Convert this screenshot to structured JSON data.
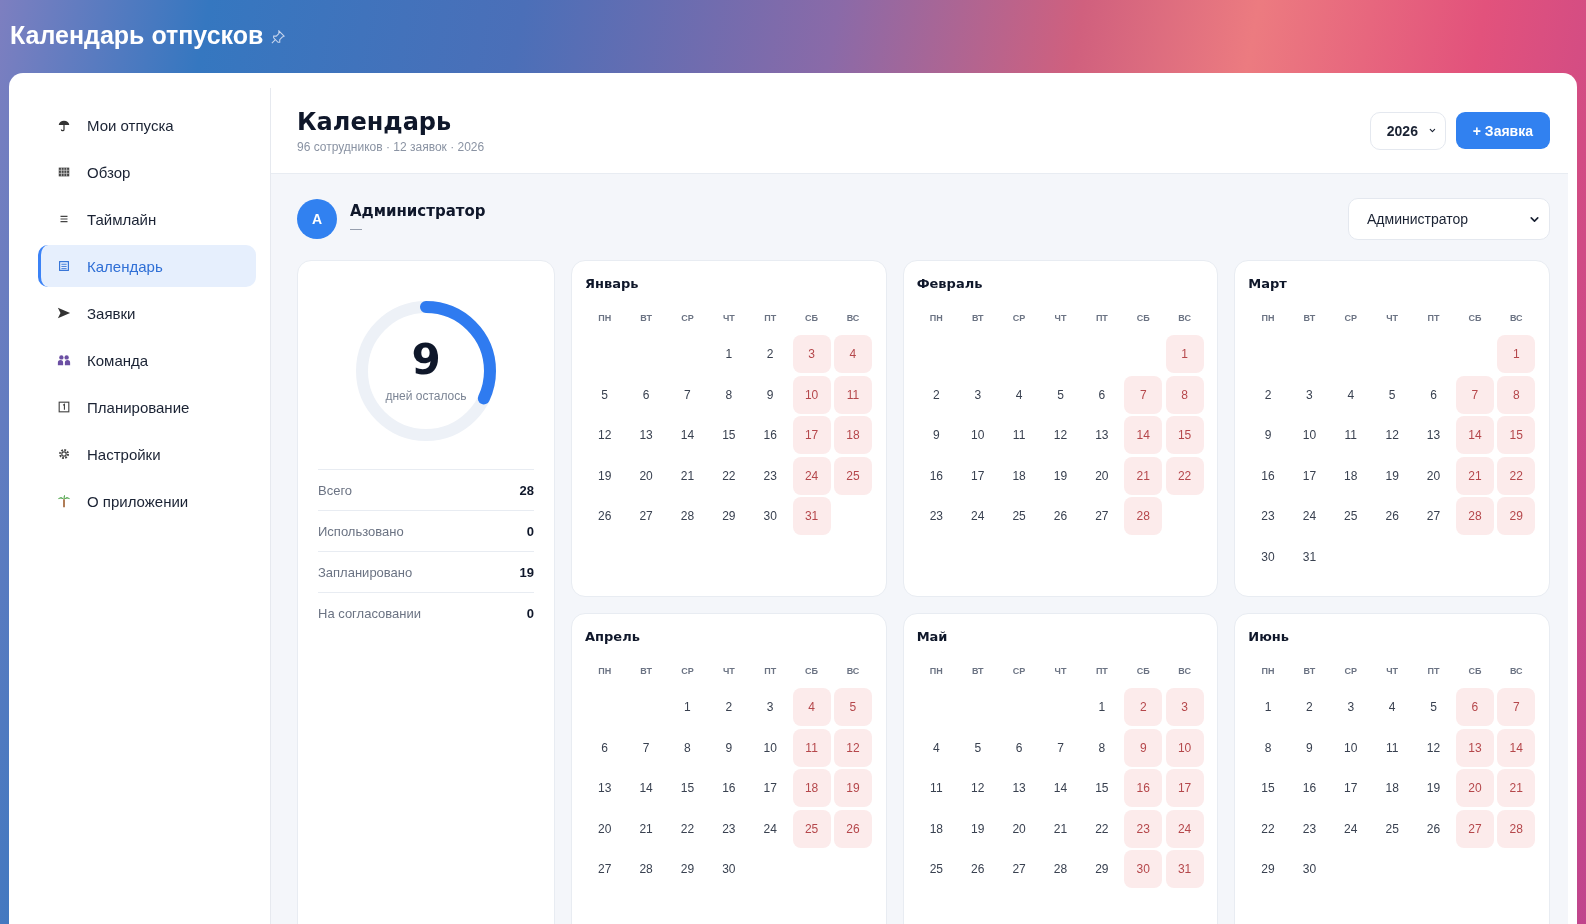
{
  "app_title": "Календарь отпусков",
  "sidebar": {
    "items": [
      {
        "label": "Мои отпуска",
        "selected": false
      },
      {
        "label": "Обзор",
        "selected": false
      },
      {
        "label": "Таймлайн",
        "selected": false
      },
      {
        "label": "Календарь",
        "selected": true
      },
      {
        "label": "Заявки",
        "selected": false
      },
      {
        "label": "Команда",
        "selected": false
      },
      {
        "label": "Планирование",
        "selected": false
      },
      {
        "label": "Настройки",
        "selected": false
      },
      {
        "label": "О приложении",
        "selected": false
      }
    ]
  },
  "header": {
    "title": "Календарь",
    "subtitle": "96 сотрудников · 12 заявок · 2026",
    "year_select": "2026",
    "new_button": "+ Заявка"
  },
  "user": {
    "avatar": "А",
    "name": "Администратор",
    "role": "—",
    "select": "Администратор"
  },
  "summary": {
    "remaining": "9",
    "remaining_label": "дней осталось",
    "level": 0.32,
    "stats": [
      {
        "label": "Всего",
        "value": "28"
      },
      {
        "label": "Использовано",
        "value": "0"
      },
      {
        "label": "Запланировано",
        "value": "19"
      },
      {
        "label": "На согласовании",
        "value": "0"
      }
    ]
  },
  "months": [
    {
      "name": "Январь",
      "weekdays": [
        "ПН",
        "ВТ",
        "СР",
        "ЧТ",
        "ПТ",
        "СБ",
        "ВС"
      ],
      "weeks": [
        [
          {
            "kind": "empty"
          },
          {
            "kind": "empty"
          },
          {
            "kind": "empty"
          },
          {
            "kind": "day",
            "day": "1",
            "weekend": false
          },
          {
            "kind": "day",
            "day": "2",
            "weekend": false
          },
          {
            "kind": "day",
            "day": "3",
            "weekend": true
          },
          {
            "kind": "day",
            "day": "4",
            "weekend": true
          }
        ],
        [
          {
            "kind": "day",
            "day": "5",
            "weekend": false
          },
          {
            "kind": "day",
            "day": "6",
            "weekend": false
          },
          {
            "kind": "day",
            "day": "7",
            "weekend": false
          },
          {
            "kind": "day",
            "day": "8",
            "weekend": false
          },
          {
            "kind": "day",
            "day": "9",
            "weekend": false
          },
          {
            "kind": "day",
            "day": "10",
            "weekend": true
          },
          {
            "kind": "day",
            "day": "11",
            "weekend": true
          }
        ],
        [
          {
            "kind": "day",
            "day": "12",
            "weekend": false
          },
          {
            "kind": "day",
            "day": "13",
            "weekend": false
          },
          {
            "kind": "day",
            "day": "14",
            "weekend": false
          },
          {
            "kind": "day",
            "day": "15",
            "weekend": false
          },
          {
            "kind": "day",
            "day": "16",
            "weekend": false
          },
          {
            "kind": "day",
            "day": "17",
            "weekend": true
          },
          {
            "kind": "day",
            "day": "18",
            "weekend": true
          }
        ],
        [
          {
            "kind": "day",
            "day": "19",
            "weekend": false
          },
          {
            "kind": "day",
            "day": "20",
            "weekend": false
          },
          {
            "kind": "day",
            "day": "21",
            "weekend": false
          },
          {
            "kind": "day",
            "day": "22",
            "weekend": false
          },
          {
            "kind": "day",
            "day": "23",
            "weekend": false
          },
          {
            "kind": "day",
            "day": "24",
            "weekend": true
          },
          {
            "kind": "day",
            "day": "25",
            "weekend": true
          }
        ],
        [
          {
            "kind": "day",
            "day": "26",
            "weekend": false
          },
          {
            "kind": "day",
            "day": "27",
            "weekend": false
          },
          {
            "kind": "day",
            "day": "28",
            "weekend": false
          },
          {
            "kind": "day",
            "day": "29",
            "weekend": false
          },
          {
            "kind": "day",
            "day": "30",
            "weekend": false
          },
          {
            "kind": "day",
            "day": "31",
            "weekend": true
          },
          {
            "kind": "empty"
          }
        ]
      ]
    },
    {
      "name": "Февраль",
      "weekdays": [
        "ПН",
        "ВТ",
        "СР",
        "ЧТ",
        "ПТ",
        "СБ",
        "ВС"
      ],
      "weeks": [
        [
          {
            "kind": "empty"
          },
          {
            "kind": "empty"
          },
          {
            "kind": "empty"
          },
          {
            "kind": "empty"
          },
          {
            "kind": "empty"
          },
          {
            "kind": "empty"
          },
          {
            "kind": "day",
            "day": "1",
            "weekend": true
          }
        ],
        [
          {
            "kind": "day",
            "day": "2",
            "weekend": false
          },
          {
            "kind": "day",
            "day": "3",
            "weekend": false
          },
          {
            "kind": "day",
            "day": "4",
            "weekend": false
          },
          {
            "kind": "day",
            "day": "5",
            "weekend": false
          },
          {
            "kind": "day",
            "day": "6",
            "weekend": false
          },
          {
            "kind": "day",
            "day": "7",
            "weekend": true
          },
          {
            "kind": "day",
            "day": "8",
            "weekend": true
          }
        ],
        [
          {
            "kind": "day",
            "day": "9",
            "weekend": false
          },
          {
            "kind": "day",
            "day": "10",
            "weekend": false
          },
          {
            "kind": "day",
            "day": "11",
            "weekend": false
          },
          {
            "kind": "day",
            "day": "12",
            "weekend": false
          },
          {
            "kind": "day",
            "day": "13",
            "weekend": false
          },
          {
            "kind": "day",
            "day": "14",
            "weekend": true
          },
          {
            "kind": "day",
            "day": "15",
            "weekend": true
          }
        ],
        [
          {
            "kind": "day",
            "day": "16",
            "weekend": false
          },
          {
            "kind": "day",
            "day": "17",
            "weekend": false
          },
          {
            "kind": "day",
            "day": "18",
            "weekend": false
          },
          {
            "kind": "day",
            "day": "19",
            "weekend": false
          },
          {
            "kind": "day",
            "day": "20",
            "weekend": false
          },
          {
            "kind": "day",
            "day": "21",
            "weekend": true
          },
          {
            "kind": "day",
            "day": "22",
            "weekend": true
          }
        ],
        [
          {
            "kind": "day",
            "day": "23",
            "weekend": false
          },
          {
            "kind": "day",
            "day": "24",
            "weekend": false
          },
          {
            "kind": "day",
            "day": "25",
            "weekend": false
          },
          {
            "kind": "day",
            "day": "26",
            "weekend": false
          },
          {
            "kind": "day",
            "day": "27",
            "weekend": false
          },
          {
            "kind": "day",
            "day": "28",
            "weekend": true
          },
          {
            "kind": "empty"
          }
        ]
      ]
    },
    {
      "name": "Март",
      "weekdays": [
        "ПН",
        "ВТ",
        "СР",
        "ЧТ",
        "ПТ",
        "СБ",
        "ВС"
      ],
      "weeks": [
        [
          {
            "kind": "empty"
          },
          {
            "kind": "empty"
          },
          {
            "kind": "empty"
          },
          {
            "kind": "empty"
          },
          {
            "kind": "empty"
          },
          {
            "kind": "empty"
          },
          {
            "kind": "day",
            "day": "1",
            "weekend": true
          }
        ],
        [
          {
            "kind": "day",
            "day": "2",
            "weekend": false
          },
          {
            "kind": "day",
            "day": "3",
            "weekend": false
          },
          {
            "kind": "day",
            "day": "4",
            "weekend": false
          },
          {
            "kind": "day",
            "day": "5",
            "weekend": false
          },
          {
            "kind": "day",
            "day": "6",
            "weekend": false
          },
          {
            "kind": "day",
            "day": "7",
            "weekend": true
          },
          {
            "kind": "day",
            "day": "8",
            "weekend": true
          }
        ],
        [
          {
            "kind": "day",
            "day": "9",
            "weekend": false
          },
          {
            "kind": "day",
            "day": "10",
            "weekend": false
          },
          {
            "kind": "day",
            "day": "11",
            "weekend": false
          },
          {
            "kind": "day",
            "day": "12",
            "weekend": false
          },
          {
            "kind": "day",
            "day": "13",
            "weekend": false
          },
          {
            "kind": "day",
            "day": "14",
            "weekend": true
          },
          {
            "kind": "day",
            "day": "15",
            "weekend": true
          }
        ],
        [
          {
            "kind": "day",
            "day": "16",
            "weekend": false
          },
          {
            "kind": "day",
            "day": "17",
            "weekend": false
          },
          {
            "kind": "day",
            "day": "18",
            "weekend": false
          },
          {
            "kind": "day",
            "day": "19",
            "weekend": false
          },
          {
            "kind": "day",
            "day": "20",
            "weekend": false
          },
          {
            "kind": "day",
            "day": "21",
            "weekend": true
          },
          {
            "kind": "day",
            "day": "22",
            "weekend": true
          }
        ],
        [
          {
            "kind": "day",
            "day": "23",
            "weekend": false
          },
          {
            "kind": "day",
            "day": "24",
            "weekend": false
          },
          {
            "kind": "day",
            "day": "25",
            "weekend": false
          },
          {
            "kind": "day",
            "day": "26",
            "weekend": false
          },
          {
            "kind": "day",
            "day": "27",
            "weekend": false
          },
          {
            "kind": "day",
            "day": "28",
            "weekend": true
          },
          {
            "kind": "day",
            "day": "29",
            "weekend": true
          }
        ],
        [
          {
            "kind": "day",
            "day": "30",
            "weekend": false
          },
          {
            "kind": "day",
            "day": "31",
            "weekend": false
          },
          {
            "kind": "empty"
          },
          {
            "kind": "empty"
          },
          {
            "kind": "empty"
          },
          {
            "kind": "empty"
          },
          {
            "kind": "empty"
          }
        ]
      ]
    },
    {
      "name": "Апрель",
      "weekdays": [
        "ПН",
        "ВТ",
        "СР",
        "ЧТ",
        "ПТ",
        "СБ",
        "ВС"
      ],
      "weeks": [
        [
          {
            "kind": "empty"
          },
          {
            "kind": "empty"
          },
          {
            "kind": "day",
            "day": "1",
            "weekend": false
          },
          {
            "kind": "day",
            "day": "2",
            "weekend": false
          },
          {
            "kind": "day",
            "day": "3",
            "weekend": false
          },
          {
            "kind": "day",
            "day": "4",
            "weekend": true
          },
          {
            "kind": "day",
            "day": "5",
            "weekend": true
          }
        ],
        [
          {
            "kind": "day",
            "day": "6",
            "weekend": false
          },
          {
            "kind": "day",
            "day": "7",
            "weekend": false
          },
          {
            "kind": "day",
            "day": "8",
            "weekend": false
          },
          {
            "kind": "day",
            "day": "9",
            "weekend": false
          },
          {
            "kind": "day",
            "day": "10",
            "weekend": false
          },
          {
            "kind": "day",
            "day": "11",
            "weekend": true
          },
          {
            "kind": "day",
            "day": "12",
            "weekend": true
          }
        ],
        [
          {
            "kind": "day",
            "day": "13",
            "weekend": false
          },
          {
            "kind": "day",
            "day": "14",
            "weekend": false
          },
          {
            "kind": "day",
            "day": "15",
            "weekend": false
          },
          {
            "kind": "day",
            "day": "16",
            "weekend": false
          },
          {
            "kind": "day",
            "day": "17",
            "weekend": false
          },
          {
            "kind": "day",
            "day": "18",
            "weekend": true
          },
          {
            "kind": "day",
            "day": "19",
            "weekend": true
          }
        ],
        [
          {
            "kind": "day",
            "day": "20",
            "weekend": false
          },
          {
            "kind": "day",
            "day": "21",
            "weekend": false
          },
          {
            "kind": "day",
            "day": "22",
            "weekend": false
          },
          {
            "kind": "day",
            "day": "23",
            "weekend": false
          },
          {
            "kind": "day",
            "day": "24",
            "weekend": false
          },
          {
            "kind": "day",
            "day": "25",
            "weekend": true
          },
          {
            "kind": "day",
            "day": "26",
            "weekend": true
          }
        ],
        [
          {
            "kind": "day",
            "day": "27",
            "weekend": false
          },
          {
            "kind": "day",
            "day": "28",
            "weekend": false
          },
          {
            "kind": "day",
            "day": "29",
            "weekend": false
          },
          {
            "kind": "day",
            "day": "30",
            "weekend": false
          },
          {
            "kind": "empty"
          },
          {
            "kind": "empty"
          },
          {
            "kind": "empty"
          }
        ]
      ]
    },
    {
      "name": "Май",
      "weekdays": [
        "ПН",
        "ВТ",
        "СР",
        "ЧТ",
        "ПТ",
        "СБ",
        "ВС"
      ],
      "weeks": [
        [
          {
            "kind": "empty"
          },
          {
            "kind": "empty"
          },
          {
            "kind": "empty"
          },
          {
            "kind": "empty"
          },
          {
            "kind": "day",
            "day": "1",
            "weekend": false
          },
          {
            "kind": "day",
            "day": "2",
            "weekend": true
          },
          {
            "kind": "day",
            "day": "3",
            "weekend": true
          }
        ],
        [
          {
            "kind": "day",
            "day": "4",
            "weekend": false
          },
          {
            "kind": "day",
            "day": "5",
            "weekend": false
          },
          {
            "kind": "day",
            "day": "6",
            "weekend": false
          },
          {
            "kind": "day",
            "day": "7",
            "weekend": false
          },
          {
            "kind": "day",
            "day": "8",
            "weekend": false
          },
          {
            "kind": "day",
            "day": "9",
            "weekend": true
          },
          {
            "kind": "day",
            "day": "10",
            "weekend": true
          }
        ],
        [
          {
            "kind": "day",
            "day": "11",
            "weekend": false
          },
          {
            "kind": "day",
            "day": "12",
            "weekend": false
          },
          {
            "kind": "day",
            "day": "13",
            "weekend": false
          },
          {
            "kind": "day",
            "day": "14",
            "weekend": false
          },
          {
            "kind": "day",
            "day": "15",
            "weekend": false
          },
          {
            "kind": "day",
            "day": "16",
            "weekend": true
          },
          {
            "kind": "day",
            "day": "17",
            "weekend": true
          }
        ],
        [
          {
            "kind": "day",
            "day": "18",
            "weekend": false
          },
          {
            "kind": "day",
            "day": "19",
            "weekend": false
          },
          {
            "kind": "day",
            "day": "20",
            "weekend": false
          },
          {
            "kind": "day",
            "day": "21",
            "weekend": false
          },
          {
            "kind": "day",
            "day": "22",
            "weekend": false
          },
          {
            "kind": "day",
            "day": "23",
            "weekend": true
          },
          {
            "kind": "day",
            "day": "24",
            "weekend": true
          }
        ],
        [
          {
            "kind": "day",
            "day": "25",
            "weekend": false
          },
          {
            "kind": "day",
            "day": "26",
            "weekend": false
          },
          {
            "kind": "day",
            "day": "27",
            "weekend": false
          },
          {
            "kind": "day",
            "day": "28",
            "weekend": false
          },
          {
            "kind": "day",
            "day": "29",
            "weekend": false
          },
          {
            "kind": "day",
            "day": "30",
            "weekend": true
          },
          {
            "kind": "day",
            "day": "31",
            "weekend": true
          }
        ]
      ]
    },
    {
      "name": "Июнь",
      "weekdays": [
        "ПН",
        "ВТ",
        "СР",
        "ЧТ",
        "ПТ",
        "СБ",
        "ВС"
      ],
      "weeks": [
        [
          {
            "kind": "day",
            "day": "1",
            "weekend": false
          },
          {
            "kind": "day",
            "day": "2",
            "weekend": false
          },
          {
            "kind": "day",
            "day": "3",
            "weekend": false
          },
          {
            "kind": "day",
            "day": "4",
            "weekend": false
          },
          {
            "kind": "day",
            "day": "5",
            "weekend": false
          },
          {
            "kind": "day",
            "day": "6",
            "weekend": true
          },
          {
            "kind": "day",
            "day": "7",
            "weekend": true
          }
        ],
        [
          {
            "kind": "day",
            "day": "8",
            "weekend": false
          },
          {
            "kind": "day",
            "day": "9",
            "weekend": false
          },
          {
            "kind": "day",
            "day": "10",
            "weekend": false
          },
          {
            "kind": "day",
            "day": "11",
            "weekend": false
          },
          {
            "kind": "day",
            "day": "12",
            "weekend": false
          },
          {
            "kind": "day",
            "day": "13",
            "weekend": true
          },
          {
            "kind": "day",
            "day": "14",
            "weekend": true
          }
        ],
        [
          {
            "kind": "day",
            "day": "15",
            "weekend": false
          },
          {
            "kind": "day",
            "day": "16",
            "weekend": false
          },
          {
            "kind": "day",
            "day": "17",
            "weekend": false
          },
          {
            "kind": "day",
            "day": "18",
            "weekend": false
          },
          {
            "kind": "day",
            "day": "19",
            "weekend": false
          },
          {
            "kind": "day",
            "day": "20",
            "weekend": true
          },
          {
            "kind": "day",
            "day": "21",
            "weekend": true
          }
        ],
        [
          {
            "kind": "day",
            "day": "22",
            "weekend": false
          },
          {
            "kind": "day",
            "day": "23",
            "weekend": false
          },
          {
            "kind": "day",
            "day": "24",
            "weekend": false
          },
          {
            "kind": "day",
            "day": "25",
            "weekend": false
          },
          {
            "kind": "day",
            "day": "26",
            "weekend": false
          },
          {
            "kind": "day",
            "day": "27",
            "weekend": true
          },
          {
            "kind": "day",
            "day": "28",
            "weekend": true
          }
        ],
        [
          {
            "kind": "day",
            "day": "29",
            "weekend": false
          },
          {
            "kind": "day",
            "day": "30",
            "weekend": false
          },
          {
            "kind": "empty"
          },
          {
            "kind": "empty"
          },
          {
            "kind": "empty"
          },
          {
            "kind": "empty"
          },
          {
            "kind": "empty"
          }
        ]
      ]
    }
  ]
}
